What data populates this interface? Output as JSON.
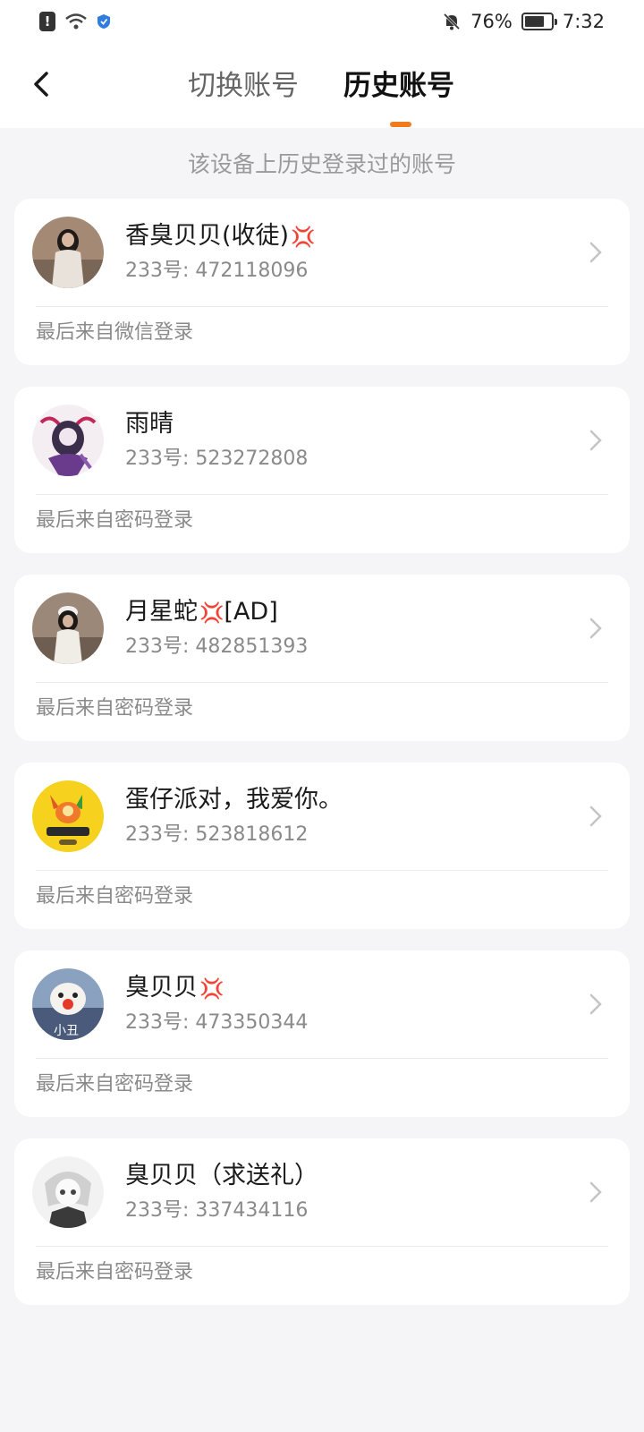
{
  "status_bar": {
    "alert_glyph": "!",
    "battery": "76%",
    "battery_level": 0.76,
    "time": "7:32",
    "icons": [
      "alert-icon",
      "wifi-icon",
      "shield-icon",
      "mute-bell-icon",
      "battery-icon"
    ]
  },
  "header": {
    "tabs": [
      {
        "label": "切换账号",
        "active": false
      },
      {
        "label": "历史账号",
        "active": true
      }
    ],
    "accent_color": "#f07b1c"
  },
  "subtitle": "该设备上历史登录过的账号",
  "accounts": [
    {
      "name": "香臭贝贝(收徒)",
      "emoji": "💢",
      "id": "233号: 472118096",
      "last_login": "最后来自微信登录",
      "avatar": "photo-girl-icon"
    },
    {
      "name": "雨晴",
      "emoji": "",
      "id": "233号: 523272808",
      "last_login": "最后来自密码登录",
      "avatar": "anime-purple-icon"
    },
    {
      "name": "月星蛇",
      "emoji": "💢",
      "suffix": "[AD]",
      "id": "233号: 482851393",
      "last_login": "最后来自密码登录",
      "avatar": "photo-girl-cap-icon"
    },
    {
      "name": "蛋仔派对，我爱你。",
      "emoji": "",
      "id": "233号: 523818612",
      "last_login": "最后来自密码登录",
      "avatar": "yellow-badge-icon"
    },
    {
      "name": "臭贝贝",
      "emoji": "💢",
      "id": "233号: 473350344",
      "last_login": "最后来自密码登录",
      "avatar": "clown-doll-icon",
      "avatar_text": "小丑"
    },
    {
      "name": "臭贝贝（求送礼）",
      "emoji": "",
      "id": "233号: 337434116",
      "last_login": "最后来自密码登录",
      "avatar": "anime-sketch-icon"
    }
  ]
}
